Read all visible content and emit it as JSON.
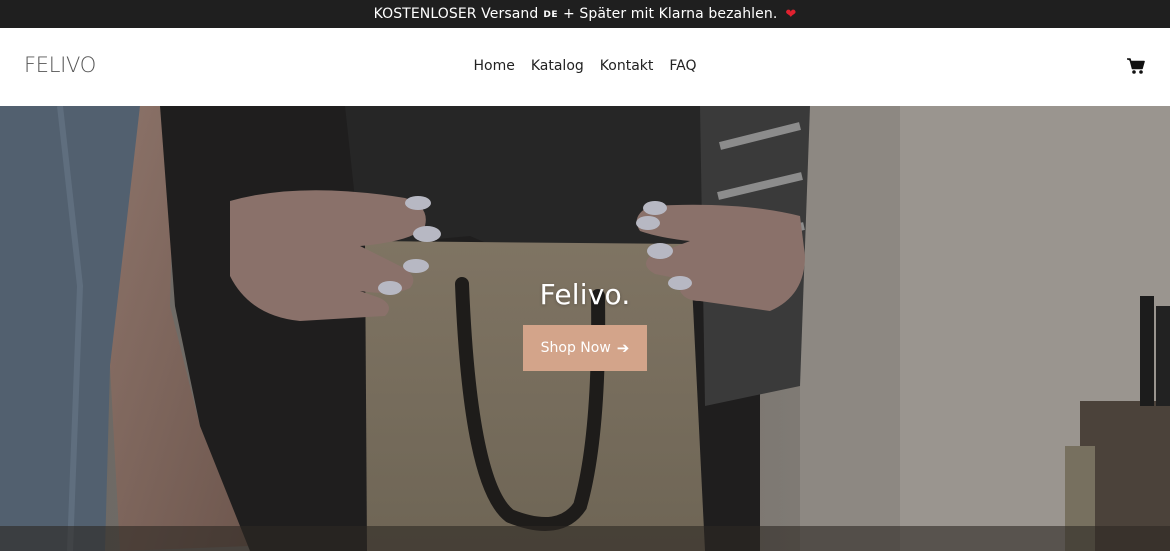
{
  "announcement": {
    "text_before": "KOSTENLOSER Versand",
    "country_code": "DE",
    "text_after": "+ Später mit Klarna bezahlen.",
    "heart": "❤"
  },
  "header": {
    "logo": "FELIVO",
    "nav": [
      {
        "label": "Home"
      },
      {
        "label": "Katalog"
      },
      {
        "label": "Kontakt"
      },
      {
        "label": "FAQ"
      }
    ],
    "cart_icon": "shopping-cart-icon"
  },
  "hero": {
    "title": "Felivo.",
    "button_label": "Shop Now",
    "button_icon": "arrow-right-icon",
    "button_color": "#d3a48a"
  },
  "colors": {
    "announcement_bg": "#1f1f1f",
    "heart": "#e0212f",
    "accent": "#d3a48a"
  }
}
